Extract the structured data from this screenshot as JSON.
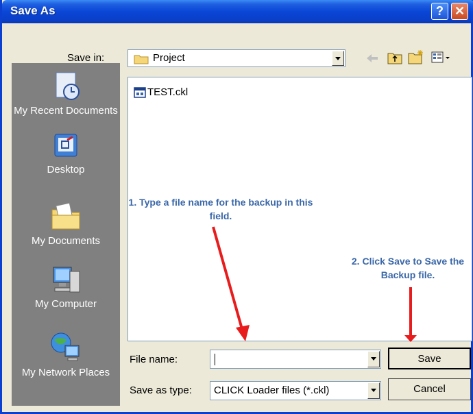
{
  "window": {
    "title": "Save As"
  },
  "titlebar": {
    "help_label": "?",
    "close_label": "✕"
  },
  "top": {
    "save_in_label": "Save in:",
    "save_in_value": "Project",
    "toolbar_icons": [
      "back-arrow-icon",
      "up-folder-icon",
      "new-folder-icon",
      "views-menu-icon"
    ]
  },
  "places": [
    {
      "label": "My Recent Documents",
      "icon": "recent-documents-icon"
    },
    {
      "label": "Desktop",
      "icon": "desktop-icon"
    },
    {
      "label": "My Documents",
      "icon": "my-documents-icon"
    },
    {
      "label": "My Computer",
      "icon": "my-computer-icon"
    },
    {
      "label": "My Network Places",
      "icon": "network-places-icon"
    }
  ],
  "files": [
    {
      "name": "TEST.ckl",
      "icon": "ckl-file-icon"
    }
  ],
  "fields": {
    "file_name_label": "File name:",
    "file_name_value": "",
    "save_type_label": "Save as type:",
    "save_type_value": "CLICK Loader files (*.ckl)"
  },
  "buttons": {
    "save": "Save",
    "cancel": "Cancel"
  },
  "annotations": {
    "step1": "1. Type a file name for the backup in this field.",
    "step2": "2. Click Save to Save the Backup file."
  },
  "colors": {
    "title_bar": "#0a46d6",
    "annotation_text": "#3a67a8",
    "arrow": "#e81c1c"
  }
}
